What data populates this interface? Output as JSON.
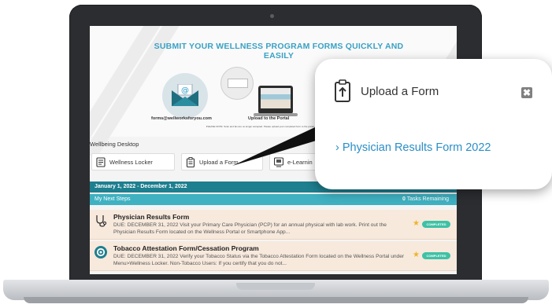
{
  "banner": {
    "title": "SUBMIT YOUR WELLNESS PROGRAM FORMS QUICKLY AND EASILY",
    "email": "forms@wellworksforyou.com",
    "portal_caption": "Upload to the Portal",
    "fine_print": "PLEASE NOTE: Scan and fax are no longer accepted. Please upload your completed form to the portal or email it. Allow time for processing."
  },
  "desktop": {
    "label": "Wellbeing Desktop",
    "tabs": [
      {
        "label": "Wellness Locker",
        "icon": "document-icon"
      },
      {
        "label": "Upload a Form",
        "icon": "clipboard-icon"
      },
      {
        "label": "e-Learnin",
        "icon": "elearning-icon"
      }
    ]
  },
  "date_range": "January 1, 2022 - December 1, 2022",
  "next_steps": {
    "label": "My Next Steps",
    "count": "0",
    "count_suffix": " Tasks Remaining"
  },
  "tasks": [
    {
      "name": "Physician Results Form",
      "desc": "DUE: DECEMBER 31, 2022 Visit your Primary Care Physician (PCP) for an annual physical with lab work. Print out the Physician Results Form located on the Wellness Portal or Smartphone App...",
      "status": "COMPLETED",
      "icon": "stethoscope-icon"
    },
    {
      "name": "Tobacco Attestation Form/Cessation Program",
      "desc": "DUE: DECEMBER 31, 2022 Verify your Tobacco Status via the Tobacco Attestation Form located on the Wellness Portal under Menu>Wellness Locker. Non-Tobacco Users: If you certify that you do not...",
      "status": "COMPLETED",
      "icon": "gear-icon"
    }
  ],
  "callout": {
    "title": "Upload a Form",
    "close_glyph": "✖",
    "link_arrow": "›",
    "link_text": "Physician Results Form 2022"
  },
  "colors": {
    "accent": "#3aa1c4",
    "datebar": "#1e7f8f",
    "nextbar": "#3fb1c1",
    "task_bg": "#f7e9dc",
    "badge": "#3fc1a6",
    "link": "#2a8fc7"
  }
}
